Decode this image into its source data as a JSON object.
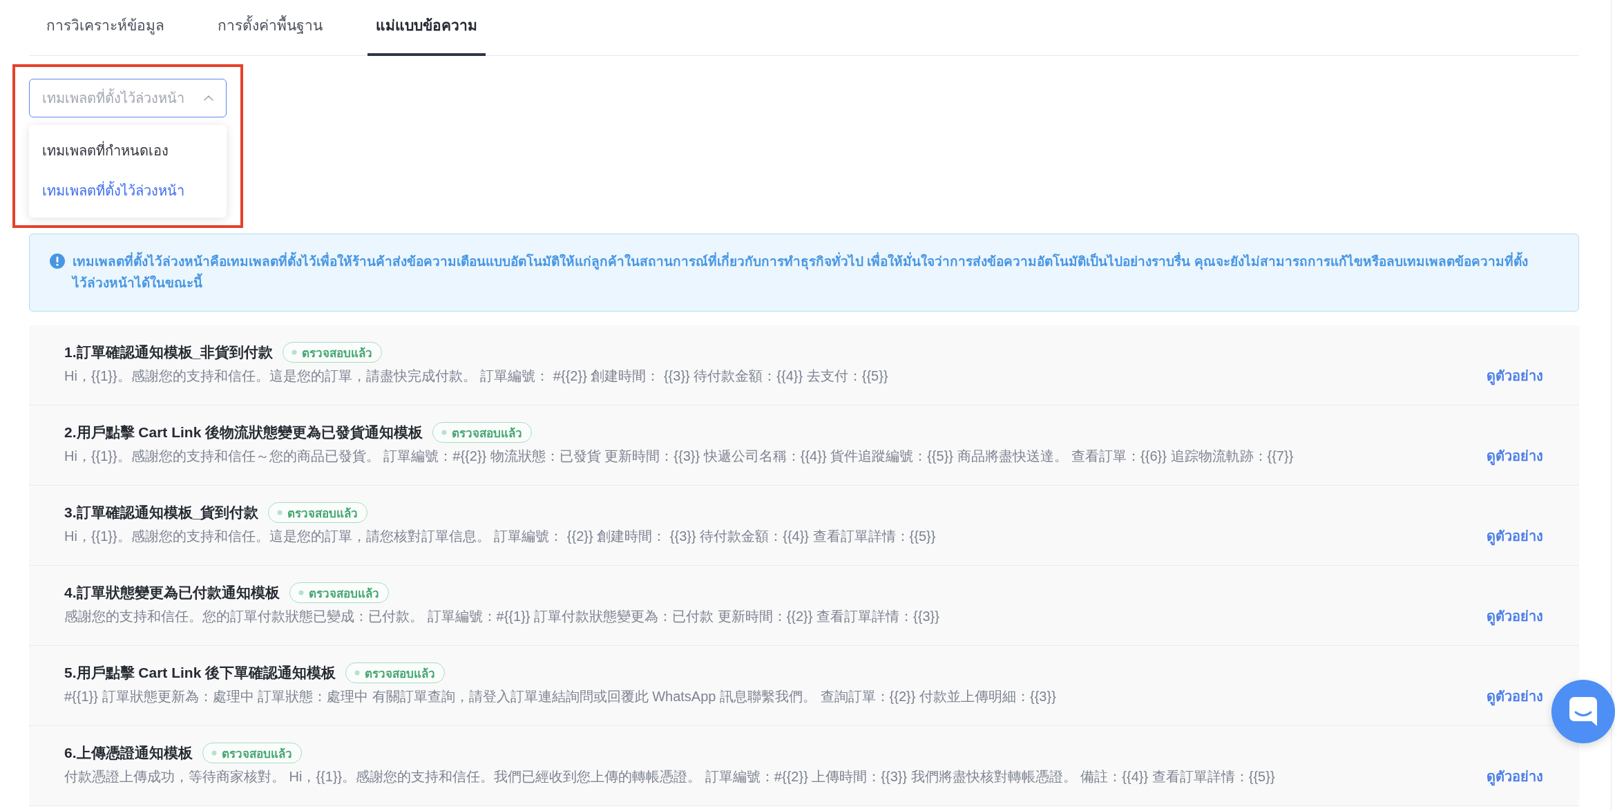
{
  "tabs": [
    {
      "label": "การวิเคราะห์ข้อมูล",
      "selected": false
    },
    {
      "label": "การตั้งค่าพื้นฐาน",
      "selected": false
    },
    {
      "label": "แม่แบบข้อความ",
      "selected": true
    }
  ],
  "template_select": {
    "value": "เทมเพลตที่ตั้งไว้ล่วงหน้า",
    "expanded": true,
    "highlighted": true,
    "options": [
      {
        "label": "เทมเพลตที่กำหนดเอง",
        "selected": false
      },
      {
        "label": "เทมเพลตที่ตั้งไว้ล่วงหน้า",
        "selected": true
      }
    ]
  },
  "notice": {
    "text": "เทมเพลตที่ตั้งไว้ล่วงหน้าคือเทมเพลตที่ตั้งไว้เพื่อให้ร้านค้าส่งข้อความเตือนแบบอัตโนมัติให้แก่ลูกค้าในสถานการณ์ที่เกี่ยวกับการทำธุรกิจทั่วไป เพื่อให้มั่นใจว่าการส่งข้อความอัตโนมัติเป็นไปอย่างราบรื่น คุณจะยังไม่สามารถการแก้ไขหรือลบเทมเพลตข้อความที่ตั้งไว้ล่วงหน้าได้ในขณะนี้"
  },
  "templates": [
    {
      "title": "1.訂單確認通知模板_非貨到付款",
      "status": "ตรวจสอบแล้ว",
      "body": "Hi，{{1}}。感謝您的支持和信任。這是您的訂單，請盡快完成付款。 訂單編號： #{{2}} 創建時間： {{3}} 待付款金額：{{4}} 去支付：{{5}}",
      "action": "ดูตัวอย่าง"
    },
    {
      "title": "2.用戶點擊 Cart Link 後物流狀態變更為已發貨通知模板",
      "status": "ตรวจสอบแล้ว",
      "body": "Hi，{{1}}。感謝您的支持和信任～您的商品已發貨。 訂單編號：#{{2}} 物流狀態：已發貨 更新時間：{{3}} 快遞公司名稱：{{4}} 貨件追蹤編號：{{5}} 商品將盡快送達。 查看訂單：{{6}} 追踪物流軌跡：{{7}}",
      "action": "ดูตัวอย่าง"
    },
    {
      "title": "3.訂單確認通知模板_貨到付款",
      "status": "ตรวจสอบแล้ว",
      "body": "Hi，{{1}}。感謝您的支持和信任。這是您的訂單，請您核對訂單信息。 訂單編號： {{2}} 創建時間： {{3}} 待付款金額：{{4}} 查看訂單詳情：{{5}}",
      "action": "ดูตัวอย่าง"
    },
    {
      "title": "4.訂單狀態變更為已付款通知模板",
      "status": "ตรวจสอบแล้ว",
      "body": "感謝您的支持和信任。您的訂單付款狀態已變成：已付款。 訂單編號：#{{1}} 訂單付款狀態變更為：已付款 更新時間：{{2}} 查看訂單詳情：{{3}}",
      "action": "ดูตัวอย่าง"
    },
    {
      "title": "5.用戶點擊 Cart Link 後下單確認通知模板",
      "status": "ตรวจสอบแล้ว",
      "body": "#{{1}} 訂單狀態更新為：處理中 訂單狀態：處理中 有關訂單查詢，請登入訂單連結詢問或回覆此 WhatsApp 訊息聯繫我們。 查詢訂單：{{2}} 付款並上傳明細：{{3}}",
      "action": "ดูตัวอย่าง"
    },
    {
      "title": "6.上傳憑證通知模板",
      "status": "ตรวจสอบแล้ว",
      "body": "付款憑證上傳成功，等待商家核對。 Hi，{{1}}。感謝您的支持和信任。我們已經收到您上傳的轉帳憑證。 訂單編號：#{{2}} 上傳時間：{{3}} 我們將盡快核對轉帳憑證。 備註：{{4}} 查看訂單詳情：{{5}}",
      "action": "ดูตัวอย่าง"
    }
  ]
}
